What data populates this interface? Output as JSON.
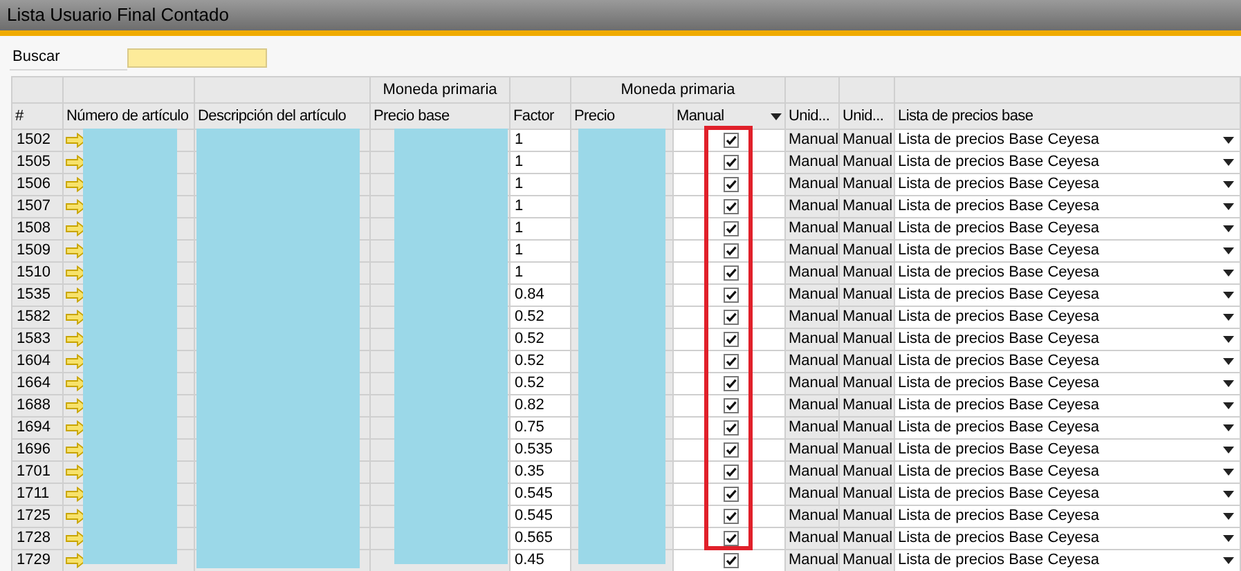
{
  "window": {
    "title": "Lista Usuario Final Contado"
  },
  "search": {
    "label": "Buscar"
  },
  "table": {
    "group_headers": [
      "Moneda primaria",
      "Moneda primaria"
    ],
    "columns": [
      "#",
      "Número de artículo",
      "Descripción del artículo",
      "Precio base",
      "Factor",
      "Precio",
      "Manual",
      "Unid...",
      "Unid...",
      "Lista de precios base"
    ],
    "rows": [
      {
        "num": "1502",
        "factor": "1",
        "checked": true,
        "unit_1": "Manual",
        "unit_2": "Manual",
        "price_list": "Lista de precios Base Ceyesa"
      },
      {
        "num": "1505",
        "factor": "1",
        "checked": true,
        "unit_1": "Manual",
        "unit_2": "Manual",
        "price_list": "Lista de precios Base Ceyesa"
      },
      {
        "num": "1506",
        "factor": "1",
        "checked": true,
        "unit_1": "Manual",
        "unit_2": "Manual",
        "price_list": "Lista de precios Base Ceyesa"
      },
      {
        "num": "1507",
        "factor": "1",
        "checked": true,
        "unit_1": "Manual",
        "unit_2": "Manual",
        "price_list": "Lista de precios Base Ceyesa"
      },
      {
        "num": "1508",
        "factor": "1",
        "checked": true,
        "unit_1": "Manual",
        "unit_2": "Manual",
        "price_list": "Lista de precios Base Ceyesa"
      },
      {
        "num": "1509",
        "factor": "1",
        "checked": true,
        "unit_1": "Manual",
        "unit_2": "Manual",
        "price_list": "Lista de precios Base Ceyesa"
      },
      {
        "num": "1510",
        "factor": "1",
        "checked": true,
        "unit_1": "Manual",
        "unit_2": "Manual",
        "price_list": "Lista de precios Base Ceyesa"
      },
      {
        "num": "1535",
        "factor": "0.84",
        "checked": true,
        "unit_1": "Manual",
        "unit_2": "Manual",
        "price_list": "Lista de precios Base Ceyesa"
      },
      {
        "num": "1582",
        "factor": "0.52",
        "checked": true,
        "unit_1": "Manual",
        "unit_2": "Manual",
        "price_list": "Lista de precios Base Ceyesa"
      },
      {
        "num": "1583",
        "factor": "0.52",
        "checked": true,
        "unit_1": "Manual",
        "unit_2": "Manual",
        "price_list": "Lista de precios Base Ceyesa"
      },
      {
        "num": "1604",
        "factor": "0.52",
        "checked": true,
        "unit_1": "Manual",
        "unit_2": "Manual",
        "price_list": "Lista de precios Base Ceyesa"
      },
      {
        "num": "1664",
        "factor": "0.52",
        "checked": true,
        "unit_1": "Manual",
        "unit_2": "Manual",
        "price_list": "Lista de precios Base Ceyesa"
      },
      {
        "num": "1688",
        "factor": "0.82",
        "checked": true,
        "unit_1": "Manual",
        "unit_2": "Manual",
        "price_list": "Lista de precios Base Ceyesa"
      },
      {
        "num": "1694",
        "factor": "0.75",
        "checked": true,
        "unit_1": "Manual",
        "unit_2": "Manual",
        "price_list": "Lista de precios Base Ceyesa"
      },
      {
        "num": "1696",
        "factor": "0.535",
        "checked": true,
        "unit_1": "Manual",
        "unit_2": "Manual",
        "price_list": "Lista de precios Base Ceyesa"
      },
      {
        "num": "1701",
        "factor": "0.35",
        "checked": true,
        "unit_1": "Manual",
        "unit_2": "Manual",
        "price_list": "Lista de precios Base Ceyesa"
      },
      {
        "num": "1711",
        "factor": "0.545",
        "checked": true,
        "unit_1": "Manual",
        "unit_2": "Manual",
        "price_list": "Lista de precios Base Ceyesa"
      },
      {
        "num": "1725",
        "factor": "0.545",
        "checked": true,
        "unit_1": "Manual",
        "unit_2": "Manual",
        "price_list": "Lista de precios Base Ceyesa"
      },
      {
        "num": "1728",
        "factor": "0.565",
        "checked": true,
        "unit_1": "Manual",
        "unit_2": "Manual",
        "price_list": "Lista de precios Base Ceyesa"
      },
      {
        "num": "1729",
        "factor": "0.45",
        "checked": true,
        "unit_1": "Manual",
        "unit_2": "Manual",
        "price_list": "Lista de precios Base Ceyesa"
      }
    ]
  }
}
